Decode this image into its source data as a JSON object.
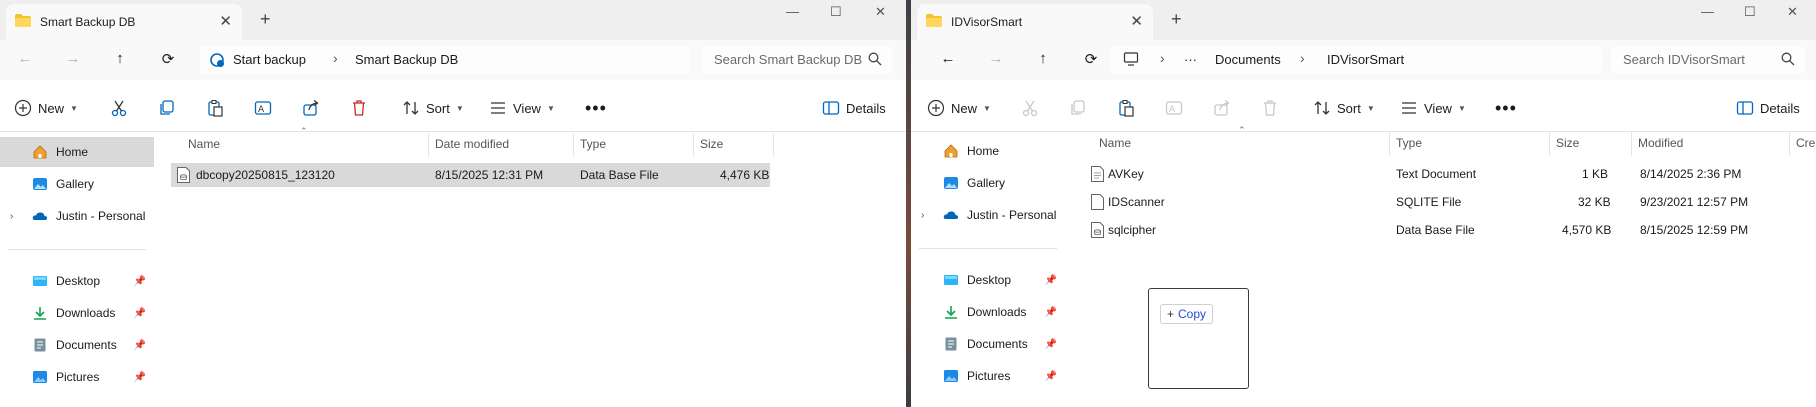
{
  "left_window": {
    "tab_title": "Smart Backup DB",
    "breadcrumbs": [
      "Start backup",
      "Smart Backup DB"
    ],
    "search_placeholder": "Search Smart Backup DB",
    "commands": {
      "new": "New",
      "sort": "Sort",
      "view": "View",
      "details": "Details"
    },
    "sidebar": [
      {
        "label": "Home",
        "icon": "home-icon",
        "selected": true
      },
      {
        "label": "Gallery",
        "icon": "gallery-icon"
      },
      {
        "label": "Justin - Personal",
        "icon": "onedrive-icon"
      },
      {
        "label": "Desktop",
        "icon": "desktop-icon",
        "pinned": true
      },
      {
        "label": "Downloads",
        "icon": "downloads-icon",
        "pinned": true
      },
      {
        "label": "Documents",
        "icon": "documents-icon",
        "pinned": true
      },
      {
        "label": "Pictures",
        "icon": "pictures-icon",
        "pinned": true
      }
    ],
    "columns": [
      "Name",
      "Date modified",
      "Type",
      "Size"
    ],
    "files": [
      {
        "name": "dbcopy20250815_123120",
        "date": "8/15/2025 12:31 PM",
        "type": "Data Base File",
        "size": "4,476 KB"
      }
    ]
  },
  "right_window": {
    "tab_title": "IDVisorSmart",
    "breadcrumbs": [
      "Documents",
      "IDVisorSmart"
    ],
    "search_placeholder": "Search IDVisorSmart",
    "commands": {
      "new": "New",
      "sort": "Sort",
      "view": "View",
      "details": "Details"
    },
    "sidebar": [
      {
        "label": "Home",
        "icon": "home-icon"
      },
      {
        "label": "Gallery",
        "icon": "gallery-icon"
      },
      {
        "label": "Justin - Personal",
        "icon": "onedrive-icon"
      },
      {
        "label": "Desktop",
        "icon": "desktop-icon",
        "pinned": true
      },
      {
        "label": "Downloads",
        "icon": "downloads-icon",
        "pinned": true
      },
      {
        "label": "Documents",
        "icon": "documents-icon",
        "pinned": true
      },
      {
        "label": "Pictures",
        "icon": "pictures-icon",
        "pinned": true
      }
    ],
    "columns": [
      "Name",
      "Type",
      "Size",
      "Modified",
      "Crea"
    ],
    "files": [
      {
        "name": "AVKey",
        "type": "Text Document",
        "size": "1 KB",
        "modified": "8/14/2025 2:36 PM"
      },
      {
        "name": "IDScanner",
        "type": "SQLITE File",
        "size": "32 KB",
        "modified": "9/23/2021 12:57 PM"
      },
      {
        "name": "sqlcipher",
        "type": "Data Base File",
        "size": "4,570 KB",
        "modified": "8/15/2025 12:59 PM"
      }
    ]
  },
  "drag": {
    "tooltip": "Copy"
  },
  "colors": {
    "accent": "#0067c0",
    "selection": "#d9d9d9",
    "folder": "#f4c430"
  }
}
